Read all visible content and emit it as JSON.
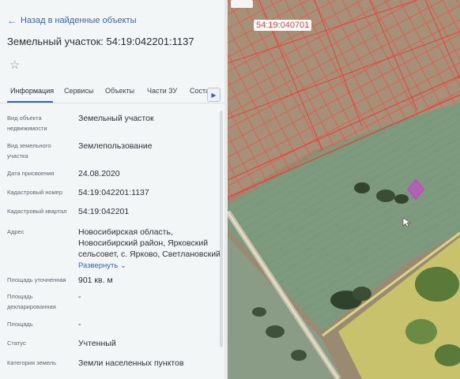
{
  "nav": {
    "back_label": "Назад в найденные объекты"
  },
  "object": {
    "title": "Земельный участок: 54:19:042201:1137"
  },
  "tabs": [
    {
      "label": "Информация"
    },
    {
      "label": "Сервисы"
    },
    {
      "label": "Объекты"
    },
    {
      "label": "Части ЗУ"
    },
    {
      "label": "Соста"
    }
  ],
  "fields": [
    {
      "label": "Вид объекта недвижимости",
      "value": "Земельный участок"
    },
    {
      "label": "Вид земельного участка",
      "value": "Землепользование"
    },
    {
      "label": "Дата присвоения",
      "value": "24.08.2020"
    },
    {
      "label": "Кадастровый номер",
      "value": "54:19:042201:1137"
    },
    {
      "label": "Кадастровый квартал",
      "value": "54:19:042201"
    },
    {
      "label": "Адрес",
      "value": "Новосибирская область, Новосибирский район, Ярковский сельсовет, с. Ярково, Светлановский"
    },
    {
      "label": "Площадь уточненная",
      "value": "901 кв. м"
    },
    {
      "label": "Площадь декларированная",
      "value": "-"
    },
    {
      "label": "Площадь",
      "value": "-"
    },
    {
      "label": "Статус",
      "value": "Учтенный"
    },
    {
      "label": "Категория земель",
      "value": "Земли населенных пунктов"
    }
  ],
  "address_expand": "Развернуть",
  "map": {
    "quarter_label": "54:19:040701"
  },
  "colors": {
    "accent": "#3a63b5",
    "parcel_border": "#e8403a",
    "highlight": "#d23cd6"
  }
}
